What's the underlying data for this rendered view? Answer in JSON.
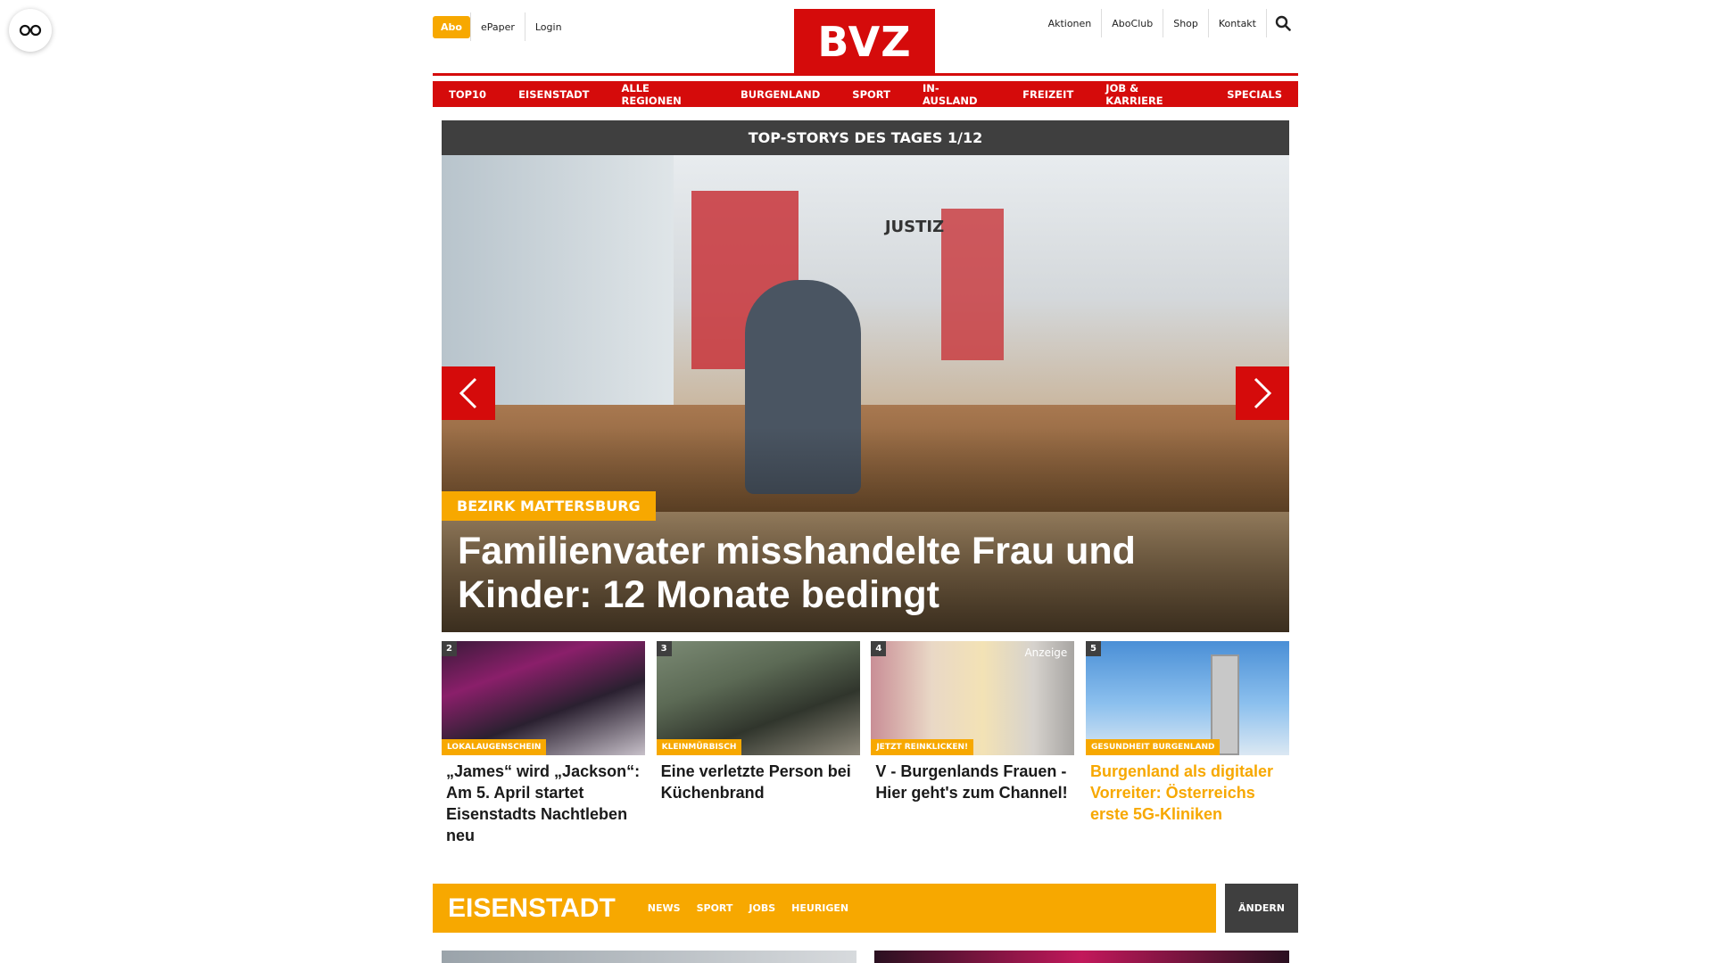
{
  "topbar": {
    "abo": "Abo",
    "links_left": [
      "ePaper",
      "Login"
    ],
    "logo": "BVZ",
    "links_right": [
      "Aktionen",
      "AboClub",
      "Shop",
      "Kontakt"
    ]
  },
  "nav": {
    "items": [
      "TOP10",
      "EISENSTADT",
      "ALLE REGIONEN",
      "BURGENLAND",
      "SPORT",
      "IN-AUSLAND",
      "FREIZEIT",
      "JOB & KARRIERE",
      "SPECIALS"
    ]
  },
  "hero": {
    "bar_title": "TOP-STORYS DES TAGES 1/12",
    "emblem_text": "JUSTIZ",
    "category": "BEZIRK MATTERSBURG",
    "title": "Familienvater misshandelte Frau und Kinder: 12 Monate bedingt"
  },
  "teasers": [
    {
      "num": "2",
      "category": "LOKALAUGENSCHEIN",
      "title": "„James“ wird „Jackson“: Am 5. April startet Eisenstadts Nachtleben neu"
    },
    {
      "num": "3",
      "category": "KLEINMÜRBISCH",
      "title": "Eine verletzte Person bei Küchenbrand"
    },
    {
      "num": "4",
      "category": "JETZT REINKLICKEN!",
      "ad": "Anzeige",
      "title": "V - Burgenlands Frauen - Hier geht's zum Channel!"
    },
    {
      "num": "5",
      "category": "GESUNDHEIT BURGENLAND",
      "title": "Burgenland als digitaler Vorreiter: Österreichs erste 5G-Kliniken"
    }
  ],
  "region": {
    "title": "EISENSTADT",
    "links": [
      "NEWS",
      "SPORT",
      "JOBS",
      "HEURIGEN"
    ],
    "change_button": "ÄNDERN"
  },
  "colors": {
    "brand_red": "#d50b0b",
    "accent_yellow": "#f7a800",
    "dark_gray": "#3f3f3f"
  }
}
